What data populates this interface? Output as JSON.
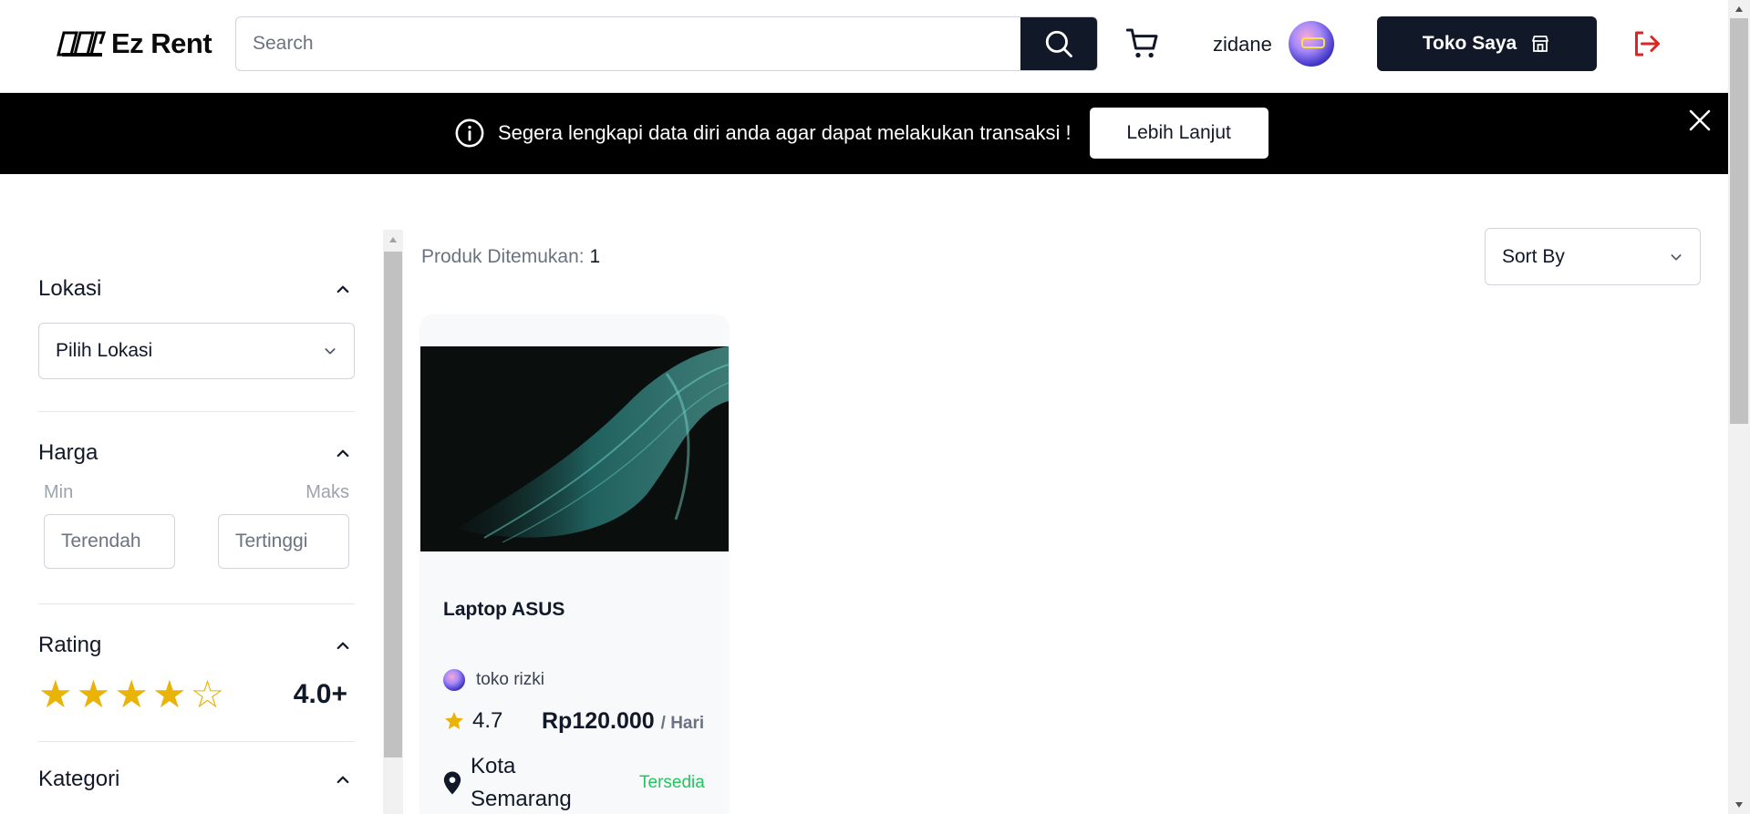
{
  "header": {
    "logo_text": "Ez Rent",
    "search_placeholder": "Search",
    "username": "zidane",
    "toko_label": "Toko Saya"
  },
  "banner": {
    "message": "Segera lengkapi data diri anda agar dapat melakukan transaksi !",
    "button_label": "Lebih Lanjut"
  },
  "filters": {
    "location": {
      "title": "Lokasi",
      "selected": "Pilih Lokasi"
    },
    "price": {
      "title": "Harga",
      "min_label": "Min",
      "max_label": "Maks",
      "min_placeholder": "Terendah",
      "max_placeholder": "Tertinggi"
    },
    "rating": {
      "title": "Rating",
      "value": "4.0+",
      "stars_filled": 4,
      "stars_total": 5
    },
    "category": {
      "title": "Kategori"
    }
  },
  "results": {
    "label": "Produk Ditemukan:",
    "count": "1",
    "sort_label": "Sort By"
  },
  "products": [
    {
      "name": "Laptop ASUS",
      "shop": "toko rizki",
      "rating": "4.7",
      "price": "Rp120.000",
      "price_unit": "/ Hari",
      "location": "Kota Semarang",
      "status": "Tersedia"
    }
  ],
  "colors": {
    "primary": "#111827",
    "banner_bg": "#000000",
    "star": "#eab308",
    "available": "#22c55e",
    "logout": "#dc2626"
  },
  "icons": [
    "search-icon",
    "cart-icon",
    "store-icon",
    "logout-icon",
    "info-icon",
    "close-icon",
    "chevron-down-icon",
    "chevron-up-icon",
    "star-icon",
    "map-pin-icon"
  ]
}
